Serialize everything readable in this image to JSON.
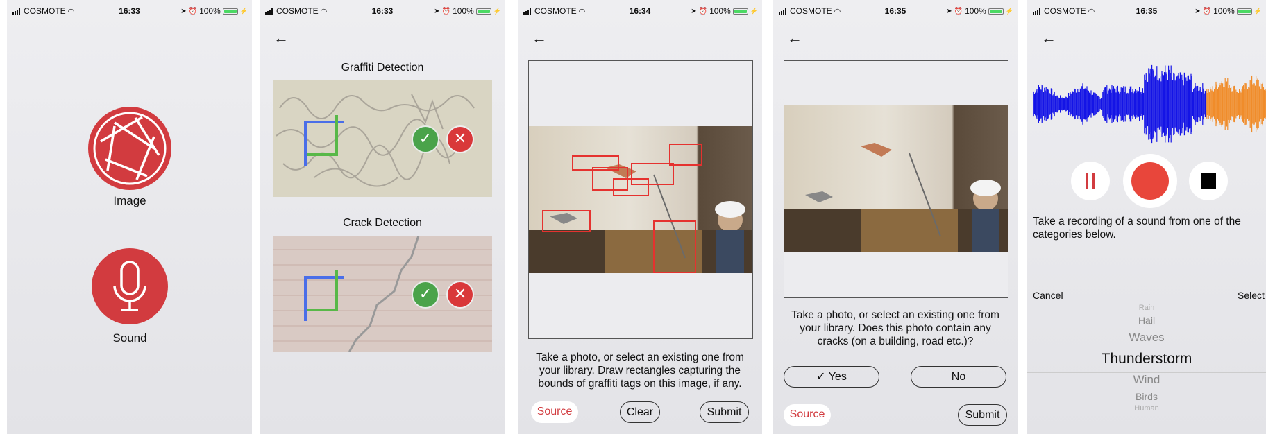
{
  "status_bars": [
    {
      "carrier": "COSMOTE",
      "time": "16:33",
      "battery": "100%"
    },
    {
      "carrier": "COSMOTE",
      "time": "16:33",
      "battery": "100%"
    },
    {
      "carrier": "COSMOTE",
      "time": "16:34",
      "battery": "100%"
    },
    {
      "carrier": "COSMOTE",
      "time": "16:35",
      "battery": "100%"
    },
    {
      "carrier": "COSMOTE",
      "time": "16:35",
      "battery": "100%"
    }
  ],
  "home": {
    "image_label": "Image",
    "sound_label": "Sound"
  },
  "detection": {
    "graffiti_title": "Graffiti Detection",
    "crack_title": "Crack Detection"
  },
  "graffiti_task": {
    "instruction": "Take a photo, or select an existing one from your library. Draw rectangles capturing the bounds of graffiti tags on this image, if any.",
    "source": "Source",
    "clear": "Clear",
    "submit": "Submit"
  },
  "crack_task": {
    "instruction": "Take a photo, or select an existing one from your library. Does this photo contain any cracks (on a building, road etc.)?",
    "yes": "✓ Yes",
    "no": "No",
    "source": "Source",
    "submit": "Submit"
  },
  "sound_task": {
    "instruction": "Take a recording of a sound from one of the categories below.",
    "cancel": "Cancel",
    "select": "Select",
    "options": [
      "Rain",
      "Hail",
      "Waves",
      "Thunderstorm",
      "Wind",
      "Birds",
      "Human"
    ],
    "selected": "Thunderstorm"
  },
  "colors": {
    "accent_red": "#d23b3f",
    "wave_blue": "#1414e6",
    "wave_orange": "#f08c2a",
    "box_red": "#e5322f"
  }
}
